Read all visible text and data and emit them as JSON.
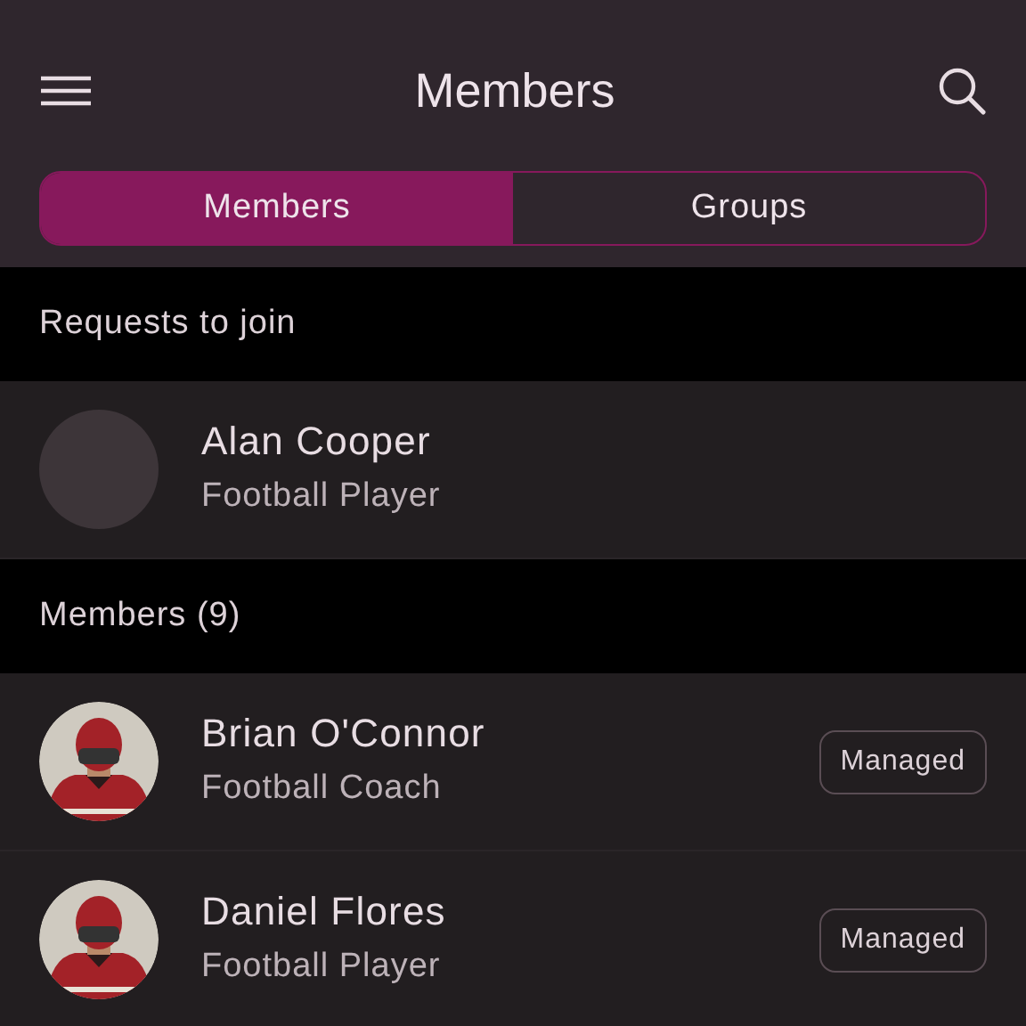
{
  "header": {
    "title": "Members"
  },
  "tabs": [
    {
      "label": "Members",
      "selected": true
    },
    {
      "label": "Groups",
      "selected": false
    }
  ],
  "sections": [
    {
      "title": "Requests to join",
      "members": [
        {
          "name": "Alan Cooper",
          "role": "Football Player",
          "avatar": {
            "kind": "placeholder"
          }
        }
      ]
    },
    {
      "title": "Members (9)",
      "members": [
        {
          "name": "Brian O'Connor",
          "role": "Football Coach",
          "badge": "Managed"
        },
        {
          "name": "Daniel Flores",
          "role": "Football Player",
          "badge": "Managed"
        }
      ]
    }
  ]
}
